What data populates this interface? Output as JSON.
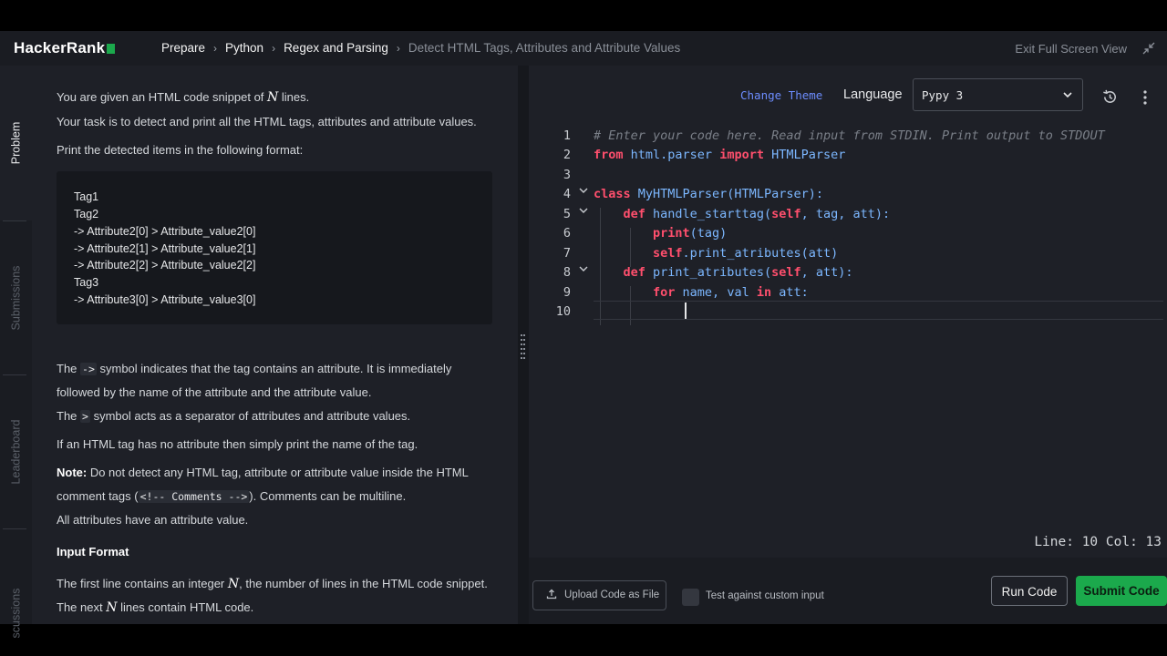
{
  "header": {
    "logo_text": "HackerRank",
    "breadcrumbs": [
      "Prepare",
      "Python",
      "Regex and Parsing",
      "Detect HTML Tags, Attributes and Attribute Values"
    ],
    "exit_label": "Exit Full Screen View",
    "brand_color": "#1ba94c"
  },
  "rail": {
    "tabs": [
      "Problem",
      "Submissions",
      "Leaderboard",
      "scussions"
    ],
    "active": "Problem"
  },
  "problem": {
    "p1_pre": "You are given an HTML code snippet of ",
    "p1_math": "N",
    "p1_post": " lines.",
    "p2": "Your task is to detect and print all the HTML tags, attributes and attribute values.",
    "p3": "Print the detected items in the following format:",
    "format_lines": [
      "Tag1",
      "Tag2",
      "->  Attribute2[0]  >  Attribute_value2[0]",
      "->  Attribute2[1]  >  Attribute_value2[1]",
      "->  Attribute2[2]  >  Attribute_value2[2]",
      "Tag3",
      "->  Attribute3[0]  >  Attribute_value3[0]"
    ],
    "p4_pre": "The ",
    "p4_code": "->",
    "p4_post": " symbol indicates that the tag contains an attribute. It is immediately",
    "p5": "followed by the name of the attribute and the attribute value.",
    "p6_pre": "The ",
    "p6_code": ">",
    "p6_post": " symbol acts as a separator of attributes and attribute values.",
    "p7": "If an HTML tag has no attribute then simply print the name of the tag.",
    "p8_bold": "Note:",
    "p8_post": " Do not detect any HTML tag, attribute or attribute value inside the HTML",
    "p9_pre": "comment tags (",
    "p9_code": "<!-- Comments -->",
    "p9_post": "). Comments can be multiline.",
    "p10": "All attributes have an attribute value.",
    "input_heading": "Input Format",
    "p11_pre": "The first line contains an integer ",
    "p11_math": "N",
    "p11_post": ", the number of lines in the HTML code snippet.",
    "p12_pre": "The next ",
    "p12_math": "N",
    "p12_post": " lines contain HTML code."
  },
  "editor": {
    "change_theme": "Change Theme",
    "language_label": "Language",
    "language_value": "Pypy 3",
    "line_numbers": [
      "1",
      "2",
      "3",
      "4",
      "5",
      "6",
      "7",
      "8",
      "9",
      "10"
    ],
    "status": "Line: 10 Col: 13",
    "code": {
      "l1": "# Enter your code here. Read input from STDIN. Print output to STDOUT",
      "l2_k1": "from",
      "l2_m": " html.parser ",
      "l2_k2": "import",
      "l2_n": " HTMLParser",
      "l4_k": "class",
      "l4_rest": " MyHTMLParser(HTMLParser):",
      "l5_k": "def",
      "l5_n": " handle_starttag",
      "l5_p1": "(",
      "l5_self": "self",
      "l5_p2": ", tag, att):",
      "l6_k": "print",
      "l6_rest": "(tag)",
      "l7_self": "self",
      "l7_rest": ".print_atributes(att)",
      "l8_k": "def",
      "l8_n": " print_atributes",
      "l8_p1": "(",
      "l8_self": "self",
      "l8_p2": ", att):",
      "l9_k1": "for",
      "l9_m1": " name, val ",
      "l9_k2": "in",
      "l9_m2": " att:"
    },
    "colors": {
      "keyword": "#ff4f6d",
      "name": "#7cb7ff",
      "comment": "#7a7f88",
      "link": "#6d8dff"
    }
  },
  "footer": {
    "upload_label": "Upload Code as File",
    "custom_input_label": "Test against custom input",
    "custom_input_checked": false,
    "run_label": "Run Code",
    "submit_label": "Submit Code"
  }
}
